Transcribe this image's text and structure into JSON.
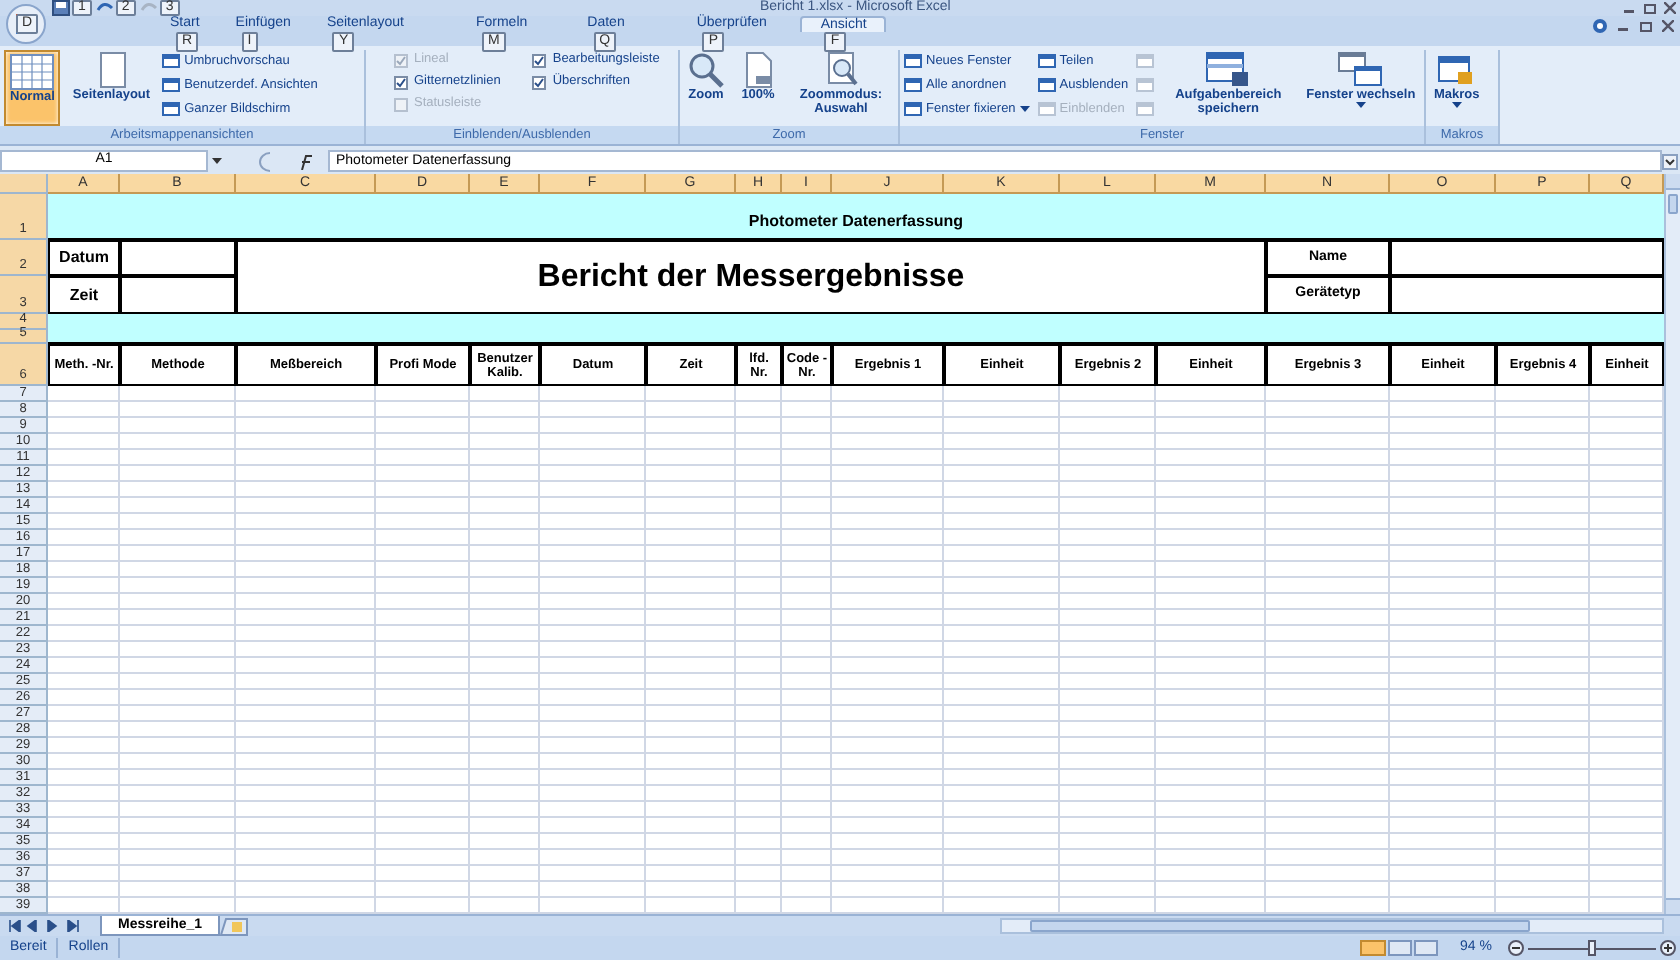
{
  "window": {
    "title": "Bericht 1.xlsx - Microsoft Excel"
  },
  "office_button": {
    "keytip": "D"
  },
  "quick_access": [
    {
      "keytip": "1"
    },
    {
      "keytip": "2"
    },
    {
      "keytip": "3"
    }
  ],
  "tabs": [
    {
      "label": "Start",
      "keytip": "R",
      "selected": false
    },
    {
      "label": "Einfügen",
      "keytip": "I",
      "selected": false
    },
    {
      "label": "Seitenlayout",
      "keytip": "Y",
      "selected": false
    },
    {
      "label": "Formeln",
      "keytip": "M",
      "selected": false
    },
    {
      "label": "Daten",
      "keytip": "Q",
      "selected": false
    },
    {
      "label": "Überprüfen",
      "keytip": "P",
      "selected": false
    },
    {
      "label": "Ansicht",
      "keytip": "F",
      "selected": true
    }
  ],
  "ribbon_groups": [
    {
      "label": "Arbeitsmappenansichten",
      "columns": [
        [
          {
            "kind": "large",
            "label": "Normal",
            "selected": true,
            "disabled": false
          }
        ],
        [
          {
            "kind": "large",
            "label": "Seitenlayout",
            "selected": false,
            "disabled": false
          }
        ],
        [
          {
            "kind": "small",
            "label": "Umbruchvorschau",
            "selected": false,
            "disabled": false
          },
          {
            "kind": "small",
            "label": "Benutzerdef. Ansichten",
            "selected": false,
            "disabled": false
          },
          {
            "kind": "small",
            "label": "Ganzer Bildschirm",
            "selected": false,
            "disabled": false
          }
        ]
      ]
    },
    {
      "label": "Einblenden/Ausblenden",
      "columns": [
        [
          {
            "kind": "checkbox",
            "label": "Lineal",
            "checked": true,
            "disabled": true
          },
          {
            "kind": "checkbox",
            "label": "Gitternetzlinien",
            "checked": true,
            "disabled": false
          },
          {
            "kind": "checkbox",
            "label": "Statusleiste",
            "checked": false,
            "disabled": true
          }
        ],
        [
          {
            "kind": "checkbox",
            "label": "Bearbeitungsleiste",
            "checked": true,
            "disabled": false
          },
          {
            "kind": "checkbox",
            "label": "Überschriften",
            "checked": true,
            "disabled": false
          }
        ]
      ]
    },
    {
      "label": "Zoom",
      "columns": [
        [
          {
            "kind": "large",
            "label": "Zoom",
            "disabled": false
          }
        ],
        [
          {
            "kind": "large",
            "label": "100%",
            "disabled": false
          }
        ],
        [
          {
            "kind": "large",
            "label": "Zoommodus: Auswahl",
            "disabled": false
          }
        ]
      ]
    },
    {
      "label": "Fenster",
      "columns": [
        [
          {
            "kind": "small",
            "label": "Neues Fenster",
            "disabled": false,
            "dropdown": false
          },
          {
            "kind": "small",
            "label": "Alle anordnen",
            "disabled": false,
            "dropdown": false
          },
          {
            "kind": "small",
            "label": "Fenster fixieren",
            "disabled": false,
            "dropdown": true
          }
        ],
        [
          {
            "kind": "small",
            "label": "Teilen",
            "disabled": false,
            "dropdown": false
          },
          {
            "kind": "small",
            "label": "Ausblenden",
            "disabled": false,
            "dropdown": false
          },
          {
            "kind": "small",
            "label": "Einblenden",
            "disabled": true,
            "dropdown": false
          }
        ],
        [
          {
            "kind": "icon",
            "disabled": true
          },
          {
            "kind": "icon",
            "disabled": true
          },
          {
            "kind": "icon",
            "disabled": true
          }
        ],
        [
          {
            "kind": "large",
            "label": "Aufgabenbereich speichern",
            "disabled": false,
            "dropdown": false
          }
        ],
        [
          {
            "kind": "large",
            "label": "Fenster wechseln",
            "disabled": false,
            "dropdown": true
          }
        ]
      ]
    },
    {
      "label": "Makros",
      "columns": [
        [
          {
            "kind": "large",
            "label": "Makros",
            "disabled": false,
            "dropdown": true
          }
        ]
      ]
    }
  ],
  "formula_bar": {
    "name_box": "A1",
    "formula": "Photometer Datenerfassung"
  },
  "columns": [
    "A",
    "B",
    "C",
    "D",
    "E",
    "F",
    "G",
    "H",
    "I",
    "J",
    "K",
    "L",
    "M",
    "N",
    "O",
    "P",
    "Q"
  ],
  "row_numbers": [
    "1",
    "2",
    "3",
    "4",
    "5",
    "6",
    "7",
    "8",
    "9",
    "10",
    "11",
    "12",
    "13",
    "14",
    "15",
    "16",
    "17",
    "18",
    "19",
    "20",
    "21",
    "22",
    "23",
    "24",
    "25",
    "26",
    "27",
    "28",
    "29",
    "30",
    "31",
    "32",
    "33",
    "34",
    "35",
    "36",
    "37",
    "38",
    "39"
  ],
  "sheet": {
    "title": "Photometer Datenerfassung",
    "heading": "Bericht der Messergebnisse",
    "left_labels": [
      "Datum",
      "Zeit"
    ],
    "right_labels": [
      "Name",
      "Gerätetyp"
    ],
    "table_headers": [
      "Meth. -Nr.",
      "Methode",
      "Meßbereich",
      "Profi Mode",
      "Benutzer Kalib.",
      "Datum",
      "Zeit",
      "lfd. Nr.",
      "Code -Nr.",
      "Ergebnis 1",
      "Einheit",
      "Ergebnis 2",
      "Einheit",
      "Ergebnis 3",
      "Einheit",
      "Ergebnis 4",
      "Einheit"
    ]
  },
  "sheet_tabs": [
    {
      "label": "Messreihe_1",
      "selected": true
    }
  ],
  "status_bar": {
    "items": [
      "Bereit",
      "Rollen"
    ],
    "zoom": "94 %",
    "zoom_slider": {
      "level": 0.5
    }
  }
}
